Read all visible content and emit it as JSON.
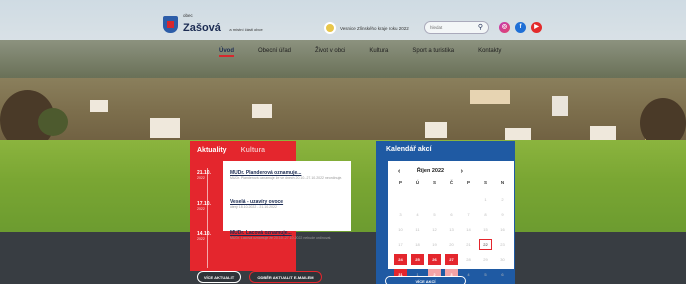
{
  "header": {
    "logo_small": "obec",
    "logo_name": "Zašová",
    "logo_sub": "a místní části obce",
    "weather_text": "Vesnice Zlínského kraje roku 2022",
    "search_placeholder": "hledat",
    "nav": [
      "Úvod",
      "Obecní úřad",
      "Život v obci",
      "Kultura",
      "Sport a turistika",
      "Kontakty"
    ]
  },
  "icons": {
    "search": "search-icon",
    "instagram": "instagram-icon",
    "facebook": "facebook-icon",
    "youtube": "youtube-icon"
  },
  "news": {
    "tabs": [
      "Aktuality",
      "Kultura"
    ],
    "items": [
      {
        "day": "21.10.",
        "year": "2022",
        "title": "MUDr. Planderová oznamuje...",
        "meta": "MUDr. Planderová oznamuje že ve dnech 20.10.-27.10.2022 neordinuje."
      },
      {
        "day": "17.10.",
        "year": "2022",
        "title": "Veselá - uzavíry ovoce"
      },
      {
        "day": "14.10.",
        "year": "2022",
        "title": "MUDr. Lacová oznamuje...",
        "meta": "MUDr. Lacová oznamuje že 20.10.-27.10.2022 nebude ordinovat."
      }
    ],
    "veselá_meta": "úterý 18.10.2022 - 21.10.2022",
    "more_label": "VÍCE AKTUALIT",
    "email_label": "ODBĚR AKTUALIT E-MAILEM"
  },
  "calendar": {
    "title": "Kalendář akcí",
    "month": "Říjen 2022",
    "prev": "‹",
    "next": "›",
    "dow": [
      "P",
      "Ú",
      "S",
      "Č",
      "P",
      "S",
      "N"
    ],
    "weeks": [
      [
        "",
        "",
        "",
        "",
        "",
        "1",
        "2"
      ],
      [
        "3",
        "4",
        "5",
        "6",
        "7",
        "8",
        "9"
      ],
      [
        "10",
        "11",
        "12",
        "13",
        "14",
        "15",
        "16"
      ],
      [
        "17",
        "18",
        "19",
        "20",
        "21",
        "22",
        "23"
      ],
      [
        "24",
        "25",
        "26",
        "27",
        "28",
        "29",
        "30"
      ],
      [
        "31",
        "1",
        "2",
        "3",
        "4",
        "5",
        "6"
      ]
    ],
    "event_days": [
      "24",
      "25",
      "26",
      "27",
      "31"
    ],
    "light_event_days": [
      "2",
      "3"
    ],
    "today": "22",
    "more_label": "VÍCE AKCÍ"
  },
  "colors": {
    "brand_red": "#e4262d",
    "brand_blue": "#1f5aa3",
    "navy": "#1c2c53"
  }
}
